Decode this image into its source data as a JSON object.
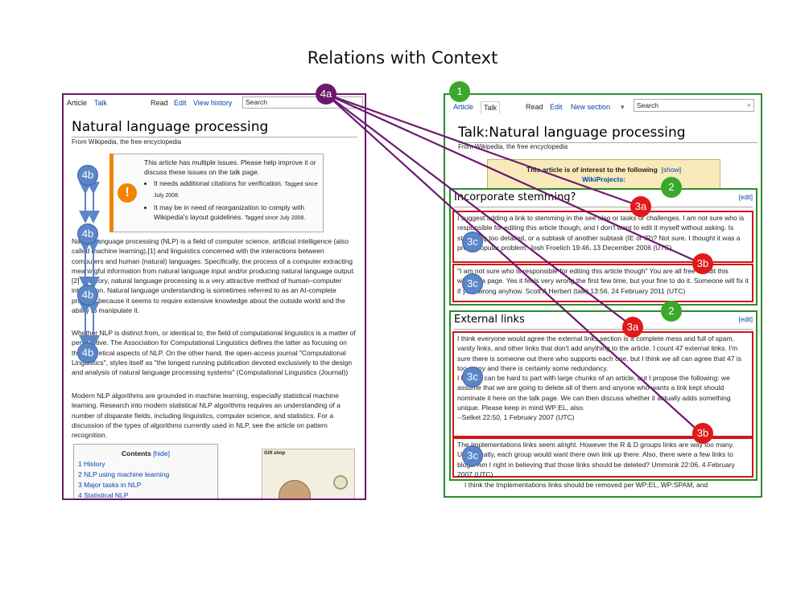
{
  "title": "Relations with Context",
  "left_page": {
    "tabs": [
      "Article",
      "Talk",
      "Read",
      "Edit",
      "View history"
    ],
    "search_placeholder": "Search",
    "heading": "Natural language processing",
    "from": "From Wikipedia, the free encyclopedia",
    "issues": {
      "icon": "!",
      "intro": "This article has multiple issues. Please help improve it or discuss these issues on the talk page.",
      "item1": "It needs additional citations for verification.",
      "item1_small": "Tagged since July 2008.",
      "item2": "It may be in need of reorganization to comply with Wikipedia's layout guidelines.",
      "item2_small": "Tagged since July 2008."
    },
    "para1": "Natural language processing (NLP) is a field of computer science, artificial intelligence (also called machine learning),[1] and linguistics concerned with the interactions between computers and human (natural) languages. Specifically, the process of a computer extracting meaningful information from natural language input and/or producing natural language output.[2] In theory, natural language processing is a very attractive method of human–computer interaction. Natural language understanding is sometimes referred to as an AI-complete problem because it seems to require extensive knowledge about the outside world and the ability to manipulate it.",
    "para2": "Whether NLP is distinct from, or identical to, the field of computational linguistics is a matter of perspective. The Association for Computational Linguistics defines the latter as focusing on the theoretical aspects of NLP. On the other hand, the open-access journal \"Computational Linguistics\", styles itself as \"the longest running publication devoted exclusively to the design and analysis of natural language processing systems\" (Computational Linguistics (Journal))",
    "para3": "Modern NLP algorithms are grounded in machine learning, especially statistical machine learning. Research into modern statistical NLP algorithms requires an understanding of a number of disparate fields, including linguistics, computer science, and statistics. For a discussion of the types of algorithms currently used in NLP, see the article on pattern recognition.",
    "contents": {
      "title": "Contents",
      "hide": "[hide]",
      "items": [
        "1 History",
        "2 NLP using machine learning",
        "3 Major tasks in NLP",
        "4 Statistical NLP"
      ]
    },
    "giftshop": "Gift shop"
  },
  "right_page": {
    "tabs": [
      "Article",
      "Talk",
      "Read",
      "Edit",
      "New section",
      "▾"
    ],
    "search_placeholder": "Search",
    "heading": "Talk:Natural language processing",
    "from": "From Wikipedia, the free encyclopedia",
    "banner_line1": "This article is of interest to the following",
    "banner_show": "[show]",
    "banner_line2": "WikiProjects:",
    "sections": [
      {
        "title": "Incorporate stemming?",
        "edit": "[edit]",
        "comments": [
          "I suggest adding a link to stemming in the see also or tasks or challenges. I am not sure who is responsible for editing this article though, and I don't want to edit it myself without asking. Is stemming too detailed, or a subtask of another subtask (IE or IR)? Not sure. I thought it was a pretty popular problem. Josh Froelich 19:46, 13 December 2006 (UTC)",
          "\"I am not sure who is responsible for editing this article though\" You are all free to edit this wikipedia page. Yes it feels very wrong the first few time, but your fine to do it. Someone will fix it if your wrong anyhow. Scott A Herbert (talk) 13:56, 24 February 2011 (UTC)"
        ]
      },
      {
        "title": "External links",
        "edit": "[edit]",
        "comments": [
          "I think everyone would agree the external links section is a complete mess and full of spam, vanity links, and other links that don't add anything to the article. I count 47 external links. I'm sure there is someone out there who supports each one, but I think we all can agree that 47 is too many and there is certainly some redundancy.\nI know it can be hard to part with large chunks of an article, but I propose the following: we assume that we are going to delete all of them and anyone who wants a link kept should nominate it here on the talk page. We can then discuss whether it actually adds something unique. Please keep in mind WP:EL, also.\n--Selket 22:50, 1 February 2007 (UTC)",
          "The Implementations links seem alright. However the R & D groups links are way too many. Unfortunatly, each group would want there own link up there. Also, there were a few links to blogs. Am I right in believing that those links should be deleted? Ummonk 22:06, 4 February 2007 (UTC)"
        ]
      }
    ],
    "trailing": "I think the Implementations links should be removed per WP:EL, WP:SPAM, and"
  },
  "badges": {
    "b1": "1",
    "b2": "2",
    "b3a": "3a",
    "b3b": "3b",
    "b3c": "3c",
    "b4a": "4a",
    "b4b": "4b"
  },
  "colors": {
    "purple": "#6a1a6e",
    "green": "#2e8b2e",
    "red": "#d01818",
    "blue": "#5b86c8"
  }
}
